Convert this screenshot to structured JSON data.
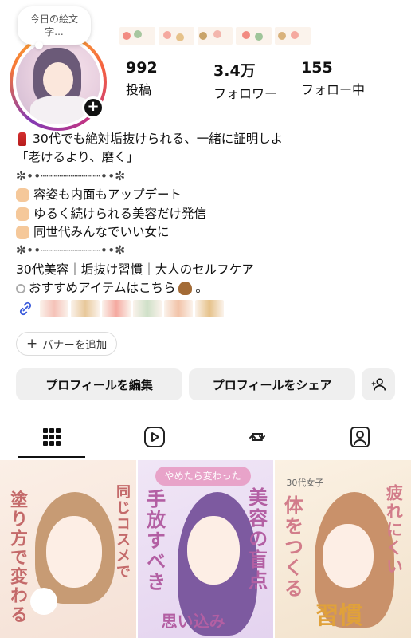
{
  "note": {
    "text": "今日の絵文字..."
  },
  "stats": [
    {
      "value": "992",
      "label": "投稿"
    },
    {
      "value": "3.4万",
      "label": "フォロワー"
    },
    {
      "value": "155",
      "label": "フォロー中"
    }
  ],
  "bio": {
    "lines": [
      "30代でも絶対垢抜けられる、一緒に証明しよ",
      "「老けるより、磨く」",
      "✼••┈┈┈┈┈┈┈┈••✼",
      "容姿も内面もアップデート",
      "ゆるく続けられる美容だけ発信",
      "同世代みんなでいい女に",
      "✼••┈┈┈┈┈┈┈┈••✼",
      "30代美容｜垢抜け習慣｜大人のセルフケア",
      "おすすめアイテムはこちら",
      "。"
    ]
  },
  "banner_button": {
    "icon": "+",
    "label": "バナーを追加"
  },
  "actions": {
    "edit": "プロフィールを編集",
    "share": "プロフィールをシェア"
  },
  "tabs": [
    {
      "name": "grid",
      "icon": "grid-icon",
      "active": true
    },
    {
      "name": "reels",
      "icon": "reels-icon",
      "active": false
    },
    {
      "name": "reposts",
      "icon": "repost-icon",
      "active": false
    },
    {
      "name": "tagged",
      "icon": "tagged-icon",
      "active": false
    }
  ],
  "posts": [
    {
      "title_a": "同じコスメで",
      "title_b": "塗り方で変わる"
    },
    {
      "ribbon": "やめたら変わった",
      "title_a": "美容の盲点",
      "title_b": "手放すべき",
      "title_c": "思い込み"
    },
    {
      "tag": "30代女子",
      "title_a": "疲れにくい",
      "title_b": "体をつくる",
      "title_c": "習慣"
    }
  ],
  "colors": {
    "accent": "#3b5bdb",
    "button_bg": "#efefef",
    "text": "#111111"
  }
}
